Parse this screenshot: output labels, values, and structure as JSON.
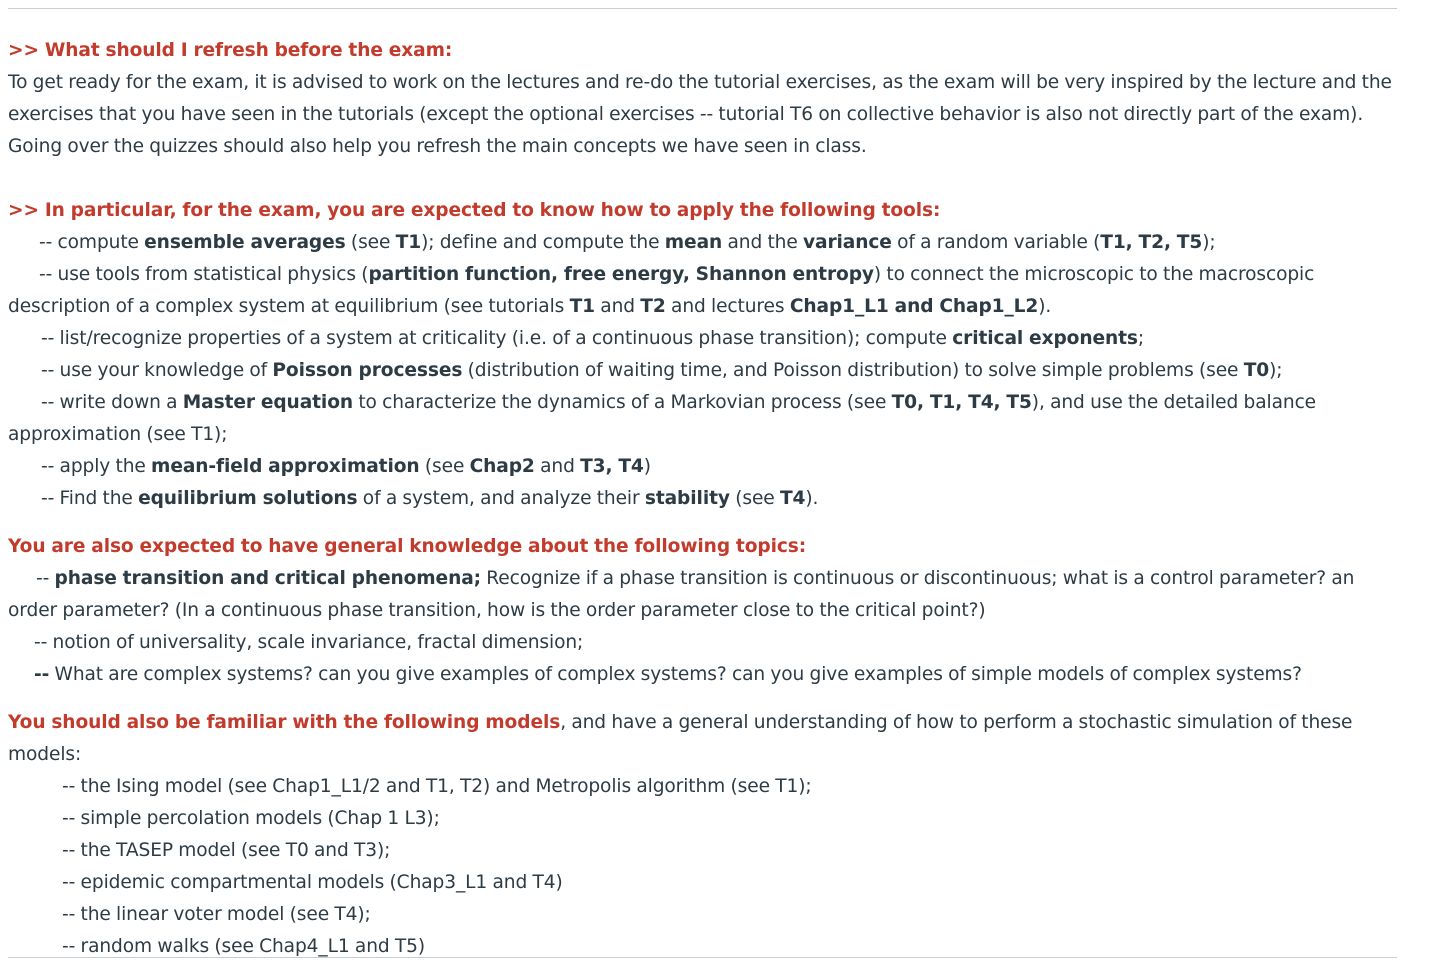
{
  "s1": {
    "heading": ">> What should I refresh before the exam:",
    "body": "To get ready for the exam, it is advised to work on the lectures and re-do the tutorial exercises, as the exam will be very inspired by the lecture and the exercises that you have seen in the tutorials (except the optional exercises -- tutorial T6 on collective behavior is also not directly part of the exam). Going over the quizzes should also help you refresh the main concepts we have seen in class."
  },
  "s2": {
    "heading": ">> In particular, for the exam, you are expected to know how to apply the following tools:",
    "i1": {
      "a": "-- compute ",
      "b": "ensemble averages",
      "c": " (see ",
      "d": "T1",
      "e": "); define and compute the ",
      "f": "mean",
      "g": " and the ",
      "h": "variance",
      "i": " of a random variable (",
      "j": "T1, T2, T5",
      "k": ");"
    },
    "i2": {
      "a": "-- use tools from statistical physics (",
      "b": "partition function, free energy, Shannon entropy",
      "c": ") to connect the microscopic to the macroscopic description of a complex system at equilibrium (see tutorials ",
      "d": "T1",
      "e": " and ",
      "f": "T2",
      "g": " and lectures ",
      "h": "Chap1_L1 and Chap1_L2",
      "i": ")."
    },
    "i3": {
      "a": "-- list/recognize properties of a system at criticality (i.e. of a continuous phase transition); compute ",
      "b": "critical exponents",
      "c": ";"
    },
    "i4": {
      "a": "-- use your knowledge of ",
      "b": "Poisson processes",
      "c": " (distribution of waiting time, and Poisson distribution) to solve simple problems (see ",
      "d": "T0",
      "e": ");"
    },
    "i5": {
      "a": "-- write down a ",
      "b": "Master equation",
      "c": " to characterize the dynamics of a Markovian process (see ",
      "d": "T0, T1, T4, T5",
      "e": "), and use the detailed balance approximation (see T1);"
    },
    "i6": {
      "a": "-- apply the ",
      "b": "mean-field approximation",
      "c": " (see ",
      "d": "Chap2",
      "e": " and ",
      "f": "T3, T4",
      "g": ")"
    },
    "i7": {
      "a": "-- Find the ",
      "b": "equilibrium solutions",
      "c": " of a system, and analyze their ",
      "d": "stability",
      "e": " (see ",
      "f": "T4",
      "g": ")."
    }
  },
  "s3": {
    "heading": "You are also expected to have general knowledge about the following topics:",
    "i1": {
      "a": "-- ",
      "b": "phase transition and critical phenomena;",
      "c": " Recognize if a phase transition is continuous or discontinuous; what is a control parameter? an order parameter? (In a continuous phase transition, how is the order parameter close to the critical point?)"
    },
    "i2": "-- notion of universality, scale invariance, fractal dimension;",
    "i3": {
      "a": "--",
      "b": " What are complex systems? can you give examples of complex systems? can you give examples of simple models of complex systems?"
    }
  },
  "s4": {
    "heading": "You should also be familiar with the following models",
    "heading_rest": ", and have a general understanding of how to perform a stochastic simulation of these models:",
    "items": [
      "-- the Ising model (see Chap1_L1/2 and T1, T2) and Metropolis algorithm (see T1);",
      "-- simple percolation models (Chap 1 L3);",
      "-- the TASEP model (see T0 and T3);",
      "-- epidemic compartmental models (Chap3_L1 and T4)",
      "-- the linear voter model (see T4);",
      "-- random walks (see Chap4_L1 and T5)"
    ]
  }
}
